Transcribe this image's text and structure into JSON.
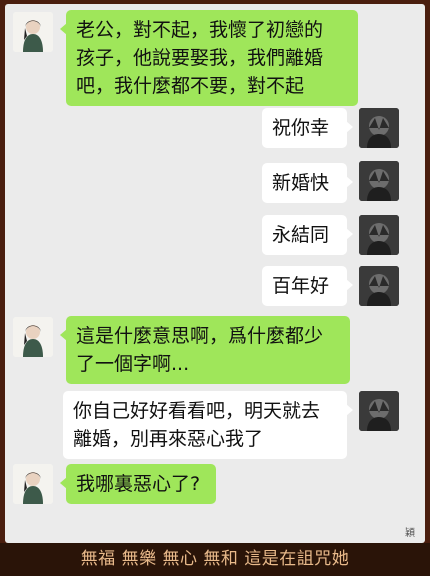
{
  "messages": [
    {
      "side": "left",
      "lines": [
        "老公，對不起，我懷了初戀的",
        "孩子，他說要娶我，我們離婚",
        "吧，我什麼都不要，對不起"
      ]
    },
    {
      "side": "right",
      "lines": [
        "祝你幸"
      ]
    },
    {
      "side": "right",
      "lines": [
        "新婚快"
      ]
    },
    {
      "side": "right",
      "lines": [
        "永結同"
      ]
    },
    {
      "side": "right",
      "lines": [
        "百年好"
      ]
    },
    {
      "side": "left",
      "lines": [
        "這是什麼意思啊，爲什麼都少",
        "了一個字啊..."
      ]
    },
    {
      "side": "right",
      "lines": [
        "你自己好好看看吧，明天就去",
        "離婚，別再來惡心我了"
      ]
    },
    {
      "side": "left",
      "lines": [
        "我哪裏惡心了?"
      ]
    }
  ],
  "watermark": "穎",
  "caption": "無福  無樂  無心  無和  這是在詛咒她",
  "colors": {
    "green_bubble": "#9fe65a",
    "white_bubble": "#ffffff",
    "chat_bg": "#ebebeb",
    "caption_text": "#e8b98a"
  }
}
